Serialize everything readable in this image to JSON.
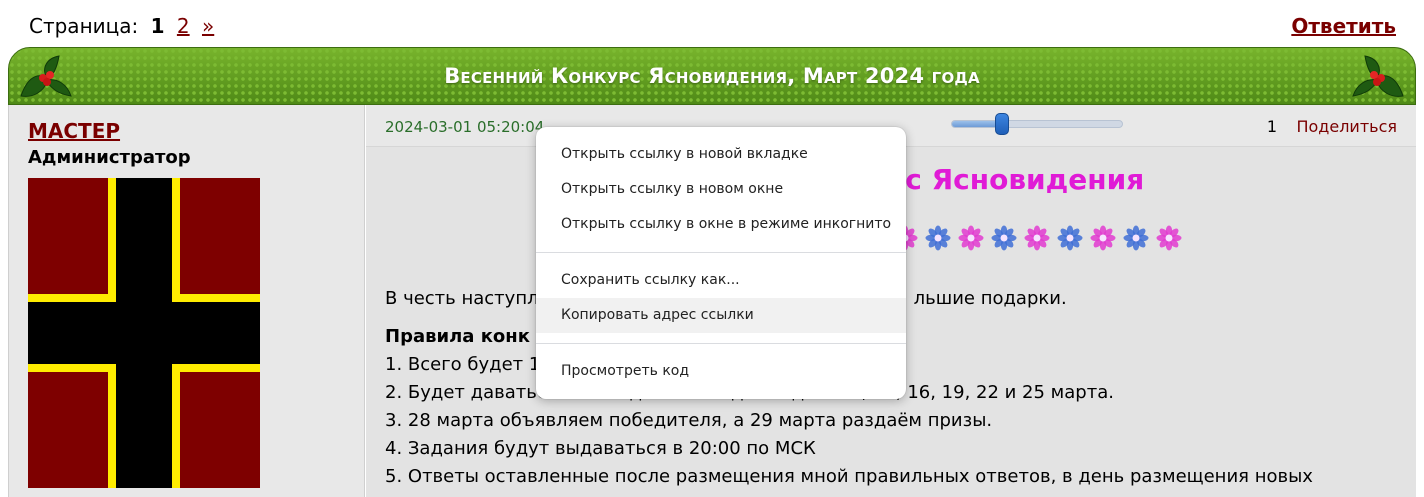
{
  "pager": {
    "label": "Страница:",
    "current": "1",
    "next_page": "2",
    "next_arrow": "»"
  },
  "reply_label": "Ответить",
  "topic": {
    "title": "Весенний Конкурс Ясновидения, Март 2024 года"
  },
  "author": {
    "name": "МАСТЕР",
    "role": "Администратор"
  },
  "post": {
    "date": "2024-03-01 05:20:04",
    "rating_slider_fraction": 0.3,
    "number": "1",
    "share_label": "Поделиться",
    "heading_visible": "ос Ясновидения",
    "intro_left": "В честь наступл",
    "intro_right": "льшие подарки.",
    "rules_heading": "Правила конк",
    "rule1": "1. Всего будет 1",
    "rule2": "2. Будет даваться по 3 задания каждые 3 дня: 10, 13, 16, 19, 22 и 25 марта.",
    "rule3": "3. 28 марта объявляем победителя, а 29 марта раздаём призы.",
    "rule4": "4. Задания будут выдаваться в 20:00 по МСК",
    "rule5": "5. Ответы оставленные после размещения мной правильных ответов, в день размещения новых"
  },
  "context_menu": {
    "items": [
      "Открыть ссылку в новой вкладке",
      "Открыть ссылку в новом окне",
      "Открыть ссылку в окне в режиме инкогнито",
      "Сохранить ссылку как...",
      "Копировать адрес ссылки",
      "Просмотреть код"
    ]
  },
  "colors": {
    "link": "#7a0000",
    "title_bar": "#5f9c1f",
    "heading": "#e01bd6",
    "date": "#2a6e2a"
  }
}
